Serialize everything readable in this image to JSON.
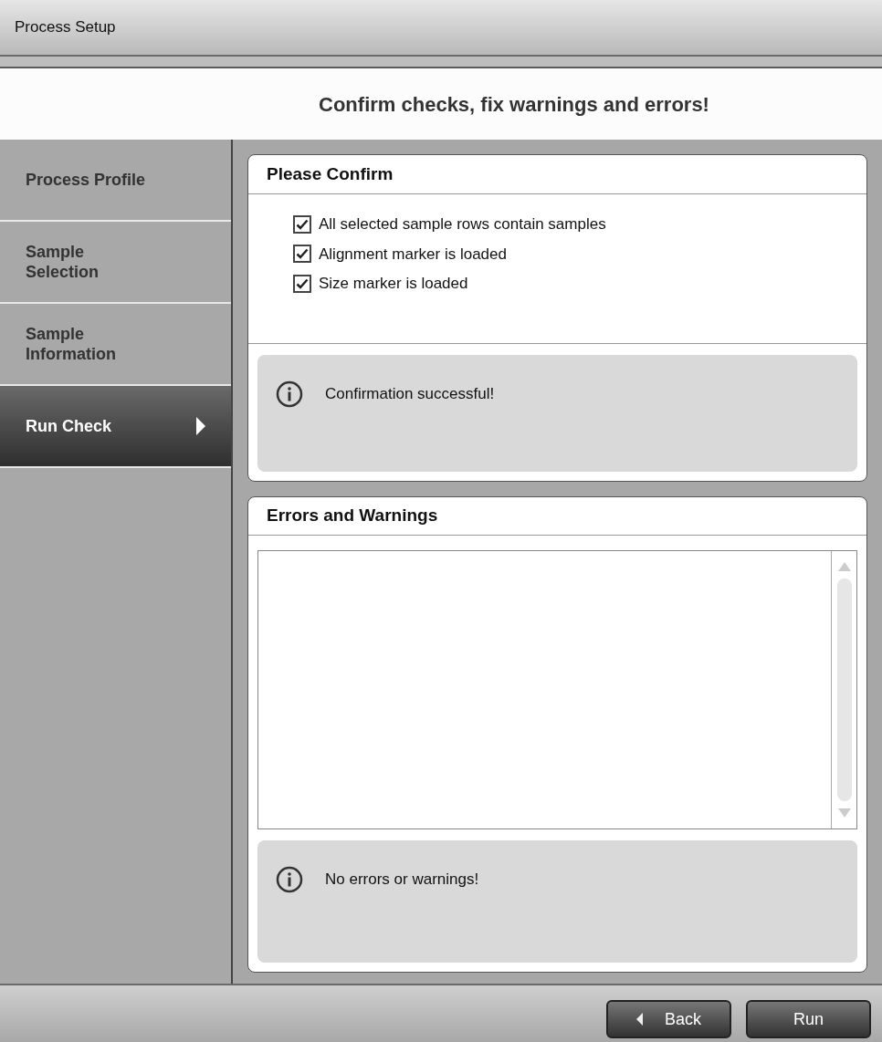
{
  "window": {
    "title": "Process Setup"
  },
  "heading": "Confirm checks, fix warnings and errors!",
  "sidebar": {
    "items": [
      {
        "label": "Process Profile",
        "selected": false
      },
      {
        "label": "Sample Selection",
        "selected": false
      },
      {
        "label": "Sample Information",
        "selected": false
      },
      {
        "label": "Run Check",
        "selected": true
      }
    ]
  },
  "confirm_panel": {
    "title": "Please Confirm",
    "checks": [
      {
        "label": "All selected sample rows contain samples",
        "checked": true
      },
      {
        "label": "Alignment marker is loaded",
        "checked": true
      },
      {
        "label": "Size marker is loaded",
        "checked": true
      }
    ],
    "message": "Confirmation successful!"
  },
  "errors_panel": {
    "title": "Errors and Warnings",
    "message": "No errors or warnings!"
  },
  "buttons": [
    {
      "label": "Back",
      "kind": "back"
    },
    {
      "label": "Run",
      "kind": "primary"
    }
  ]
}
